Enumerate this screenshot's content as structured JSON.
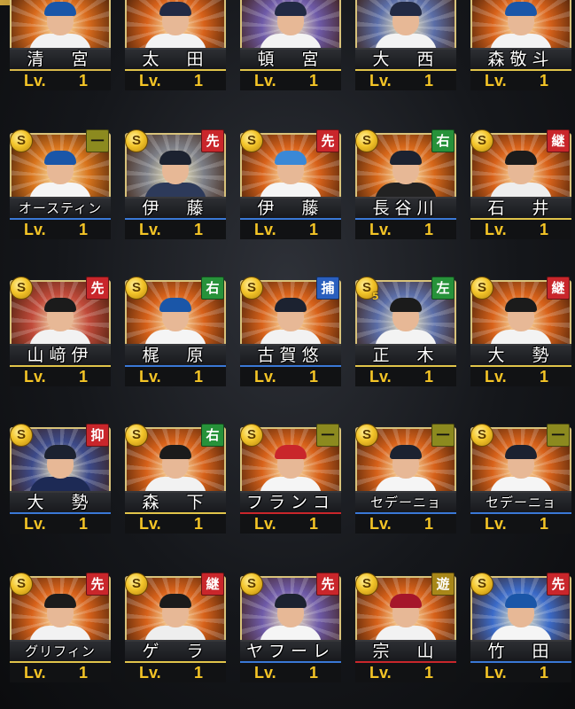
{
  "level_label": "Lv.",
  "cards": [
    {
      "name": "清　宮",
      "level": "1",
      "badge": "",
      "coin": "",
      "pos_color": "",
      "bg": "#d86a1c",
      "stripe": "#d9b84a",
      "uniform": "#f2f2f2",
      "cap": "#1a56a8"
    },
    {
      "name": "太　田",
      "level": "1",
      "badge": "",
      "coin": "",
      "pos_color": "",
      "bg": "#d8621a",
      "stripe": "#e1c44a",
      "uniform": "#f3f3f3",
      "cap": "#222a44"
    },
    {
      "name": "頓　宮",
      "level": "1",
      "badge": "",
      "coin": "",
      "pos_color": "",
      "bg": "#6e5aa8",
      "stripe": "#e1c44a",
      "uniform": "#f3f3f3",
      "cap": "#222a44"
    },
    {
      "name": "大　西",
      "level": "1",
      "badge": "",
      "coin": "",
      "pos_color": "",
      "bg": "#5b6ea8",
      "stripe": "#e1c44a",
      "uniform": "#f3f3f3",
      "cap": "#222a44"
    },
    {
      "name": "森敬斗",
      "level": "1",
      "badge": "",
      "coin": "",
      "pos_color": "",
      "bg": "#d8621a",
      "stripe": "#e1c44a",
      "uniform": "#f3f3f3",
      "cap": "#1a56a8"
    },
    {
      "name": "オースティン",
      "level": "1",
      "badge": "一",
      "coin": "S",
      "pos_color": "olive",
      "bg": "#d8741c",
      "stripe": "#3a78d6",
      "uniform": "#f5f5f5",
      "cap": "#1a56a8",
      "small": true
    },
    {
      "name": "伊　藤",
      "level": "1",
      "badge": "先",
      "coin": "S",
      "pos_color": "red",
      "bg": "#7c7e86",
      "stripe": "#3a78d6",
      "uniform": "#2d3a5a",
      "cap": "#1c2230"
    },
    {
      "name": "伊　藤",
      "level": "1",
      "badge": "先",
      "coin": "S",
      "pos_color": "red",
      "bg": "#d8621a",
      "stripe": "#3a78d6",
      "uniform": "#f5f5f5",
      "cap": "#3a88d6"
    },
    {
      "name": "長谷川",
      "level": "1",
      "badge": "右",
      "coin": "S",
      "pos_color": "green",
      "bg": "#d8681a",
      "stripe": "#3a78d6",
      "uniform": "#222",
      "cap": "#1c2230"
    },
    {
      "name": "石　井",
      "level": "1",
      "badge": "継",
      "coin": "S",
      "pos_color": "red",
      "bg": "#d8621a",
      "stripe": "#e1c44a",
      "uniform": "#eeeeee",
      "cap": "#1b1b1b"
    },
    {
      "name": "山﨑伊",
      "level": "1",
      "badge": "先",
      "coin": "S",
      "pos_color": "red",
      "bg": "#c04a3a",
      "stripe": "#e1c44a",
      "uniform": "#f2f2f2",
      "cap": "#1b1b1b"
    },
    {
      "name": "梶　原",
      "level": "1",
      "badge": "右",
      "coin": "S",
      "pos_color": "green",
      "bg": "#d8621a",
      "stripe": "#3a78d6",
      "uniform": "#f5f5f5",
      "cap": "#1a56a8"
    },
    {
      "name": "古賀悠",
      "level": "1",
      "badge": "捕",
      "coin": "S",
      "pos_color": "blue",
      "bg": "#d8621a",
      "stripe": "#3a78d6",
      "uniform": "#f2f2f2",
      "cap": "#1c2230"
    },
    {
      "name": "正　木",
      "level": "1",
      "badge": "左",
      "coin": "S",
      "pos_color": "green",
      "bg": "#5b6ea8",
      "stripe": "#e1c44a",
      "uniform": "#f3f3f3",
      "cap": "#1b1b1b"
    },
    {
      "name": "大　勢",
      "level": "1",
      "badge": "継",
      "coin": "S",
      "pos_color": "red",
      "bg": "#d8621a",
      "stripe": "#e1c44a",
      "uniform": "#f3f3f3",
      "cap": "#1b1b1b"
    },
    {
      "name": "大　勢",
      "level": "1",
      "badge": "抑",
      "coin": "S",
      "pos_color": "red",
      "bg": "#3c4a8a",
      "stripe": "#3a78d6",
      "uniform": "#1d2a55",
      "cap": "#1c2230"
    },
    {
      "name": "森　下",
      "level": "1",
      "badge": "右",
      "coin": "S",
      "pos_color": "green",
      "bg": "#d8621a",
      "stripe": "#e1c44a",
      "uniform": "#f2f2f2",
      "cap": "#1b1b1b"
    },
    {
      "name": "フランコ",
      "level": "1",
      "badge": "一",
      "coin": "S",
      "pos_color": "olive",
      "bg": "#d8621a",
      "stripe": "#c9262b",
      "uniform": "#f5f5f5",
      "cap": "#c9262b"
    },
    {
      "name": "セデーニョ",
      "level": "1",
      "badge": "一",
      "coin": "S",
      "pos_color": "olive",
      "bg": "#d8621a",
      "stripe": "#3a78d6",
      "uniform": "#f5f5f5",
      "cap": "#1c2230",
      "small": true
    },
    {
      "name": "セデーニョ",
      "level": "1",
      "badge": "一",
      "coin": "S",
      "pos_color": "olive",
      "bg": "#d8621a",
      "stripe": "#3a78d6",
      "uniform": "#f5f5f5",
      "cap": "#1c2230",
      "small": true
    },
    {
      "name": "グリフィン",
      "level": "1",
      "badge": "先",
      "coin": "S",
      "pos_color": "red",
      "bg": "#d8621a",
      "stripe": "#e1c44a",
      "uniform": "#f2f2f2",
      "cap": "#1b1b1b",
      "small": true
    },
    {
      "name": "ゲ　ラ",
      "level": "1",
      "badge": "継",
      "coin": "S",
      "pos_color": "red",
      "bg": "#d8621a",
      "stripe": "#e1c44a",
      "uniform": "#eeeeee",
      "cap": "#1b1b1b"
    },
    {
      "name": "ヤフーレ",
      "level": "1",
      "badge": "先",
      "coin": "S",
      "pos_color": "red",
      "bg": "#6e5aa8",
      "stripe": "#3a78d6",
      "uniform": "#f5f5f5",
      "cap": "#1c2230"
    },
    {
      "name": "宗　山",
      "level": "1",
      "badge": "遊",
      "coin": "S",
      "pos_color": "gold",
      "bg": "#d8621a",
      "stripe": "#c9262b",
      "uniform": "#f2f2f2",
      "cap": "#a5162a"
    },
    {
      "name": "竹　田",
      "level": "1",
      "badge": "先",
      "coin": "S",
      "pos_color": "red",
      "bg": "#3a6ac8",
      "stripe": "#3a78d6",
      "uniform": "#f5f5f5",
      "cap": "#1a56a8"
    }
  ],
  "card_level_badge": "5"
}
